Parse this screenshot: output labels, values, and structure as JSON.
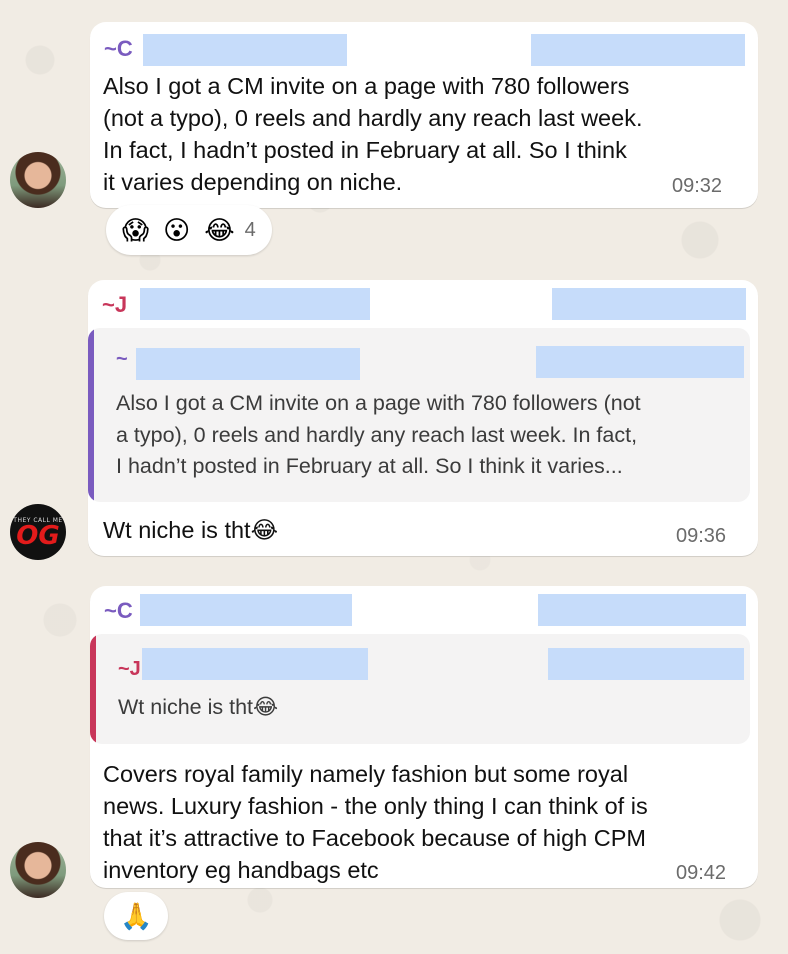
{
  "messages": [
    {
      "sender": "~C",
      "sender_color": "#7a5bbf",
      "text": "Also I got a CM invite on a page with 780 followers\n(not a typo), 0 reels and hardly any reach last week.\nIn fact, I hadn’t posted in February at all.  So I think\nit varies depending on niche.",
      "time": "09:32",
      "reactions": [
        "😱",
        "😮",
        "😂"
      ],
      "reaction_count": "4"
    },
    {
      "sender": "~J",
      "sender_color": "#c8365a",
      "quote": {
        "sender": "~",
        "sender_color": "#7a5bbf",
        "bar_color": "#7a5bbf",
        "text": "Also I got a CM invite on a page with 780 followers (not\na typo), 0 reels and hardly any reach last week. In fact,\nI hadn’t posted in February at all.  So I think it varies..."
      },
      "text": "Wt niche is tht😂",
      "time": "09:36"
    },
    {
      "sender": "~C",
      "sender_color": "#7a5bbf",
      "quote": {
        "sender": "~J",
        "sender_color": "#c8365a",
        "bar_color": "#c8365a",
        "text": "Wt niche is tht😂"
      },
      "text": "Covers royal family namely fashion but some royal\nnews. Luxury fashion - the only thing I can think of is\nthat it’s attractive to Facebook because of high CPM\ninventory eg handbags etc",
      "time": "09:42",
      "reactions": [
        "🙏"
      ]
    }
  ],
  "avatars": {
    "og_top_text": "THEY CALL ME",
    "og_main_text": "OG"
  }
}
